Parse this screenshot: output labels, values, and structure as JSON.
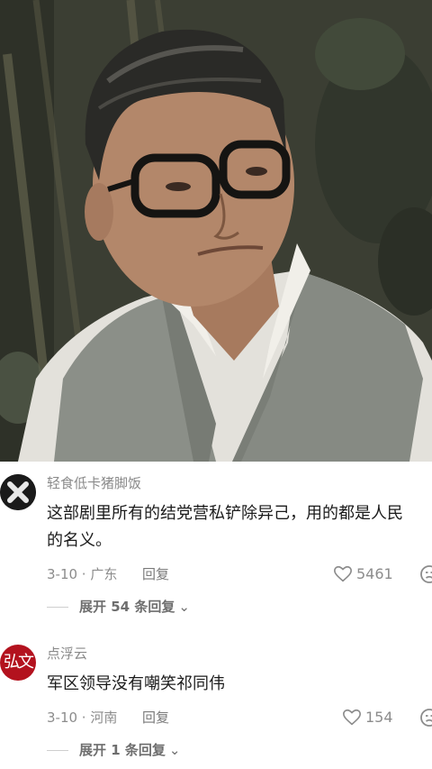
{
  "video": {
    "scene": "video-still"
  },
  "comments": [
    {
      "avatar_icon": "x-circle-avatar",
      "username": "轻食低卡猪脚饭",
      "text_lines": [
        "这部剧里所有的结党营私铲除异己，用的都是人民",
        "的名义。"
      ],
      "date_location": "3-10 · 广东",
      "reply_label": "回复",
      "likes": "5461",
      "expand_label": "展开 54 条回复"
    },
    {
      "avatar_icon": "red-seal-avatar",
      "avatar_text": "弘文",
      "username": "点浮云",
      "text_lines": [
        "军区领导没有嘲笑祁同伟"
      ],
      "date_location": "3-10 · 河南",
      "reply_label": "回复",
      "likes": "154",
      "expand_label": "展开 1 条回复"
    }
  ],
  "colors": {
    "meta": "#8c8c8c",
    "username": "#8a8a8a",
    "text": "#1b1b1b",
    "avatar_red": "#b3121e"
  }
}
